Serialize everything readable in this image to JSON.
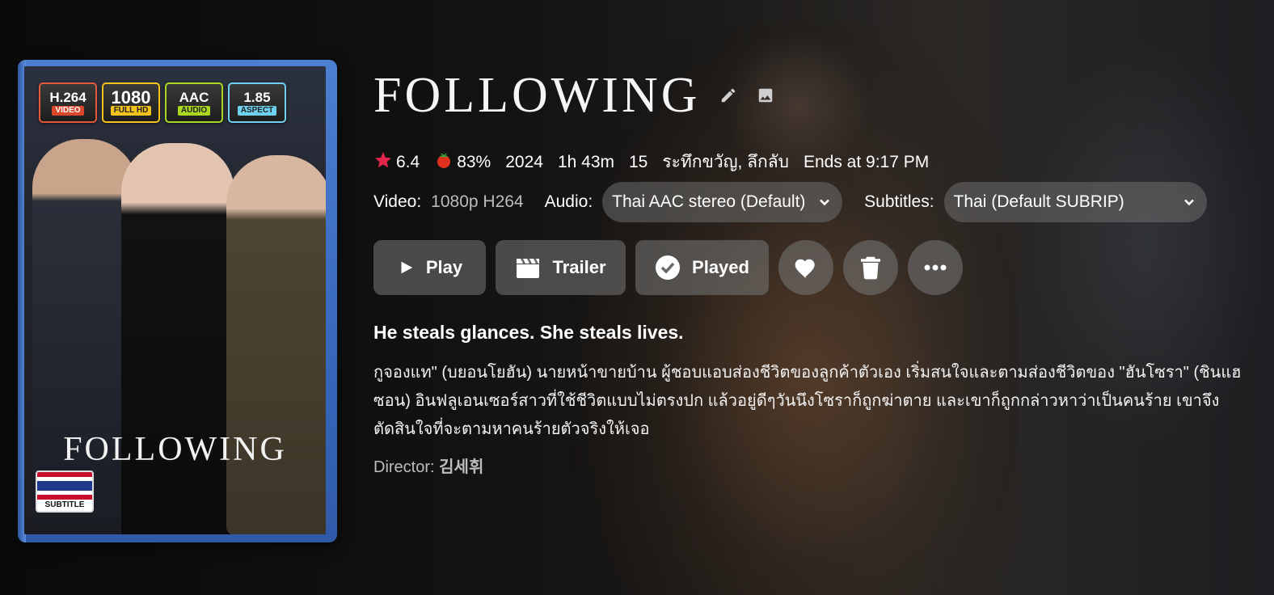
{
  "poster": {
    "badges": [
      {
        "main": "H.264",
        "sub": "VIDEO"
      },
      {
        "main": "1080",
        "sub": "FULL HD"
      },
      {
        "main": "AAC",
        "sub": "AUDIO"
      },
      {
        "main": "1.85",
        "sub": "ASPECT"
      }
    ],
    "title": "FOLLOWING",
    "subtitle_flag_label": "SUBTITLE"
  },
  "title": "FOLLOWING",
  "meta": {
    "community_rating": "6.4",
    "critic_rating": "83%",
    "year": "2024",
    "runtime": "1h 43m",
    "age_rating": "15",
    "genres": "ระทึกขวัญ, ลึกลับ",
    "ends_at": "Ends at 9:17 PM"
  },
  "media": {
    "video_label": "Video:",
    "video_value": "1080p H264",
    "audio_label": "Audio:",
    "audio_value": "Thai AAC stereo (Default)",
    "subtitles_label": "Subtitles:",
    "subtitles_value": "Thai (Default SUBRIP)"
  },
  "buttons": {
    "play": "Play",
    "trailer": "Trailer",
    "played": "Played"
  },
  "tagline": "He steals glances. She steals lives.",
  "overview": "กูจองแท\" (บยอนโยฮัน) นายหน้าขายบ้าน ผู้ชอบแอบส่องชีวิตของลูกค้าตัวเอง เริ่มสนใจและตามส่องชีวิตของ \"ฮันโซรา\" (ชินแฮซอน) อินฟลูเอนเซอร์สาวที่ใช้ชีวิตแบบไม่ตรงปก แล้วอยู่ดีๆวันนึงโซราก็ถูกฆ่าตาย และเขาก็ถูกกล่าวหาว่าเป็นคนร้าย เขาจึงตัดสินใจที่จะตามหาคนร้ายตัวจริงให้เจอ",
  "director": {
    "label": "Director:",
    "name": "김세휘"
  },
  "colors": {
    "star": "#e3254c",
    "tomato": "#e0301e",
    "poster_case": "#3a6bc0"
  },
  "icons": [
    "edit-icon",
    "image-icon",
    "star-icon",
    "tomato-icon",
    "chevron-down-icon",
    "play-icon",
    "clapperboard-icon",
    "check-circle-icon",
    "heart-icon",
    "trash-icon",
    "more-horizontal-icon"
  ]
}
